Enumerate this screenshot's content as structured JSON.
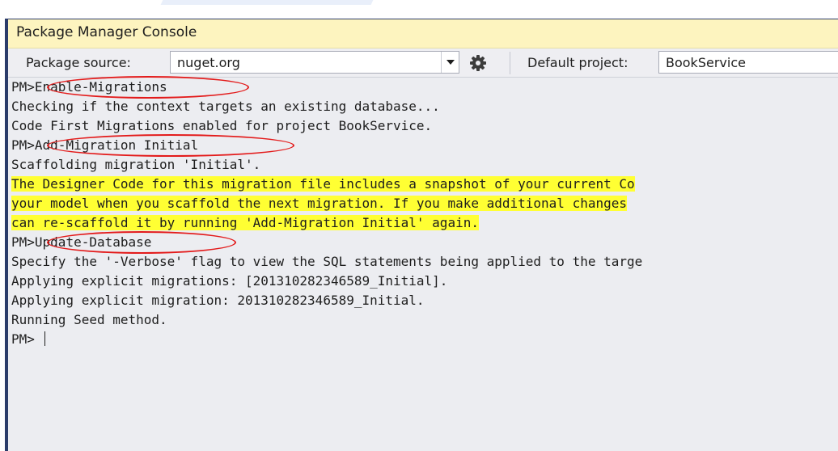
{
  "window": {
    "title": "Package Manager Console"
  },
  "toolbar": {
    "source_label": "Package source:",
    "source_value": "nuget.org",
    "project_label": "Default project:",
    "project_value": "BookService"
  },
  "console": {
    "prompt": "PM>",
    "lines": [
      {
        "type": "command",
        "prompt": "PM>",
        "text": "Enable-Migrations"
      },
      {
        "type": "output",
        "text": "Checking if the context targets an existing database..."
      },
      {
        "type": "output",
        "text": "Code First Migrations enabled for project BookService."
      },
      {
        "type": "command",
        "prompt": "PM>",
        "text": "Add-Migration Initial"
      },
      {
        "type": "output",
        "text": "Scaffolding migration 'Initial'."
      },
      {
        "type": "warning",
        "text": "The Designer Code for this migration file includes a snapshot of your current Co"
      },
      {
        "type": "warning",
        "text": "your model when you scaffold the next migration. If you make additional changes"
      },
      {
        "type": "warning",
        "text": "can re-scaffold it by running 'Add-Migration Initial' again."
      },
      {
        "type": "command",
        "prompt": "PM>",
        "text": "Update-Database"
      },
      {
        "type": "output",
        "text": "Specify the '-Verbose' flag to view the SQL statements being applied to the targe"
      },
      {
        "type": "output",
        "text": "Applying explicit migrations: [201310282346589_Initial]."
      },
      {
        "type": "output",
        "text": "Applying explicit migration: 201310282346589_Initial."
      },
      {
        "type": "output",
        "text": "Running Seed method."
      }
    ],
    "current_prompt": "PM>"
  },
  "icons": {
    "dropdown": "chevron-down-icon",
    "settings": "gear-icon"
  },
  "colors": {
    "title_bar": "#fdf4bf",
    "highlight": "#ffff33",
    "annotation": "#e31b1b",
    "window_border": "#2b3c6a"
  }
}
